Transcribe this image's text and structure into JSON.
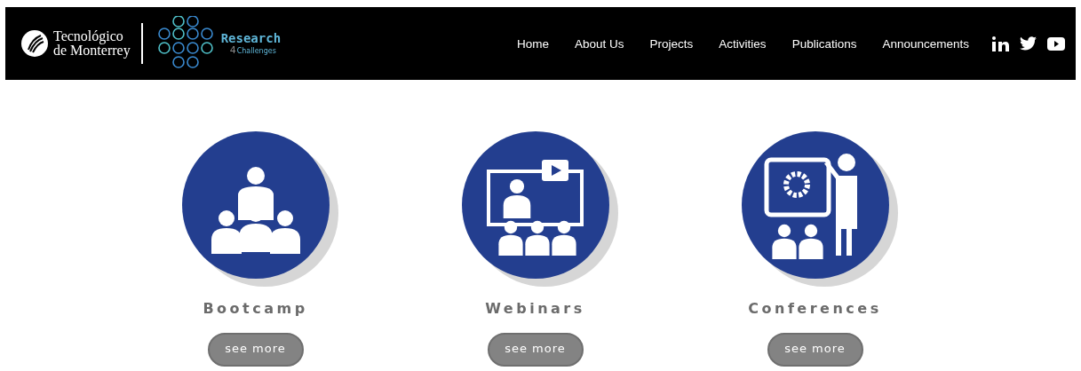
{
  "header": {
    "brand": {
      "line_1": "Tecnológico",
      "line_2": "de Monterrey"
    },
    "project_logo": {
      "title": "Research",
      "number": "4",
      "subtitle": "Challenges"
    },
    "nav": [
      {
        "label": "Home"
      },
      {
        "label": "About Us"
      },
      {
        "label": "Projects"
      },
      {
        "label": "Activities"
      },
      {
        "label": "Publications"
      },
      {
        "label": "Announcements"
      }
    ],
    "social": [
      {
        "kind": "linkedin"
      },
      {
        "kind": "twitter"
      },
      {
        "kind": "youtube"
      }
    ]
  },
  "cards": [
    {
      "kind": "bootcamp",
      "title": "Bootcamp",
      "button": "see more"
    },
    {
      "kind": "webinar",
      "title": "Webinars",
      "button": "see more"
    },
    {
      "kind": "conference",
      "title": "Conferences",
      "button": "see more"
    }
  ]
}
